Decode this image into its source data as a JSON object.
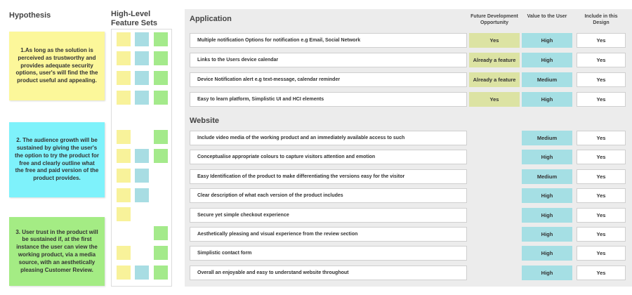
{
  "hypothesis_title": "Hypothesis",
  "features_title_line1": "High-Level",
  "features_title_line2": "Feature Sets",
  "hypotheses": [
    {
      "text": "1.As long as the solution is perceived as trustworthy and provides adequate security options, user's will find the the product useful and appealing.",
      "color": "#fcf79a"
    },
    {
      "text": "2. The audience growth will be sustained by giving the user's  the option to try the product for free and clearly outline what the free and paid version of the product provides.",
      "color": "#7ef2fb"
    },
    {
      "text": "3. User trust in the product will be sustained if, at the first instance the user can view the working product, via a media source,  with an aesthetically pleasing Customer Review.",
      "color": "#a4ec84"
    }
  ],
  "feature_set_grid": [
    [
      "yellow",
      "blue",
      "green"
    ],
    [
      "yellow",
      "blue",
      "green"
    ],
    [
      "yellow",
      "blue",
      "green"
    ],
    [
      "yellow",
      "blue",
      "green"
    ],
    [
      "yellow",
      null,
      "green"
    ],
    [
      "yellow",
      "blue",
      "green"
    ],
    [
      "yellow",
      "blue",
      null
    ],
    [
      "yellow",
      "blue",
      null
    ],
    [
      "yellow",
      null,
      null
    ],
    [
      null,
      null,
      "green"
    ],
    [
      "yellow",
      null,
      "green"
    ],
    [
      "yellow",
      "blue",
      "green"
    ]
  ],
  "columns": {
    "future": "Future Development Opportunity",
    "value": "Value to the User",
    "include": "Include in this Design"
  },
  "application": {
    "title": "Application",
    "rows": [
      {
        "feature": "Multiple notification Options for notification e.g Email, Social Network",
        "future": "Yes",
        "value": "High",
        "include": "Yes"
      },
      {
        "feature": "Links to the Users device calendar",
        "future": "Already a feature",
        "value": "High",
        "include": "Yes"
      },
      {
        "feature": "Device Notification alert  e.g  text-message, calendar reminder",
        "future": "Already a feature",
        "value": "Medium",
        "include": "Yes"
      },
      {
        "feature": "Easy to learn platform, Simplistic UI and HCI elements",
        "future": "Yes",
        "value": "High",
        "include": "Yes"
      }
    ]
  },
  "website": {
    "title": "Website",
    "rows": [
      {
        "feature": "Include video media of the working product and an immediately available access to such",
        "value": "Medium",
        "include": "Yes"
      },
      {
        "feature": "Conceptualise appropriate colours to capture visitors attention and emotion",
        "value": "High",
        "include": "Yes"
      },
      {
        "feature": "Easy Identification of the product to make differentiating the versions easy for the visitor",
        "value": "Medium",
        "include": "Yes"
      },
      {
        "feature": "Clear description of what each version of the product includes",
        "value": "High",
        "include": "Yes"
      },
      {
        "feature": "Secure yet simple checkout experience",
        "value": "High",
        "include": "Yes"
      },
      {
        "feature": "Aesthetically pleasing and visual experience from the review section",
        "value": "High",
        "include": "Yes"
      },
      {
        "feature": "Simplistic contact form",
        "value": "High",
        "include": "Yes"
      },
      {
        "feature": "Overall an enjoyable and easy to understand website throughout",
        "value": "High",
        "include": "Yes"
      }
    ]
  }
}
